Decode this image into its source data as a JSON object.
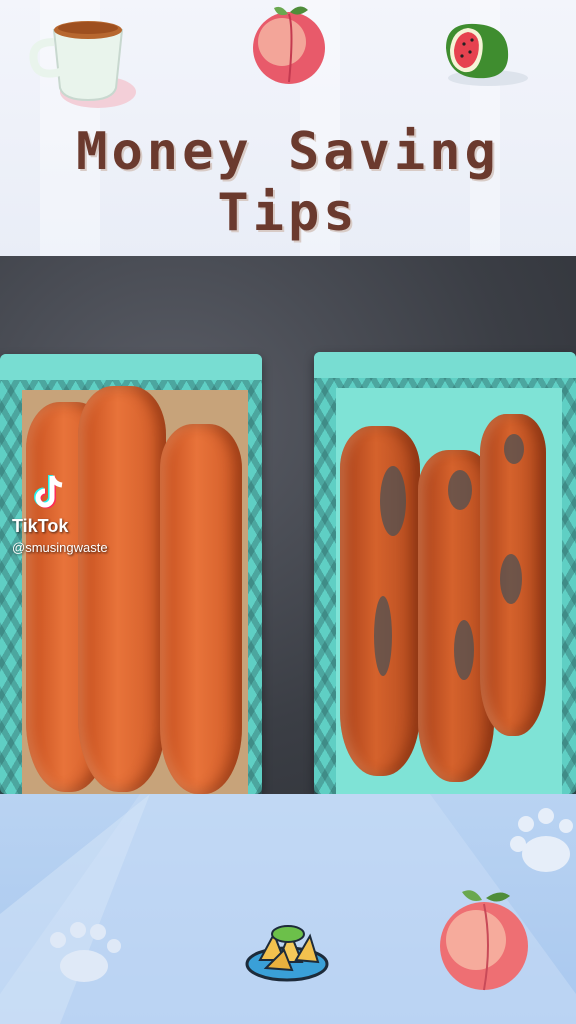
{
  "header": {
    "title_line1": "Money Saving",
    "title_line2": "Tips"
  },
  "watermark": {
    "brand": "TikTok",
    "handle": "@smusingwaste"
  },
  "decorations": {
    "top_left": "tea-cup-icon",
    "top_center": "peach-icon",
    "top_right": "watermelon-icon",
    "bottom_center": "nachos-plate-icon",
    "bottom_right": "peach-icon",
    "paw_prints": "paw-print-icon"
  },
  "colors": {
    "title": "#6b3a2e",
    "basket": "#5fcfc4",
    "carrot": "#e8733a",
    "footer": "#b9d3f2"
  }
}
